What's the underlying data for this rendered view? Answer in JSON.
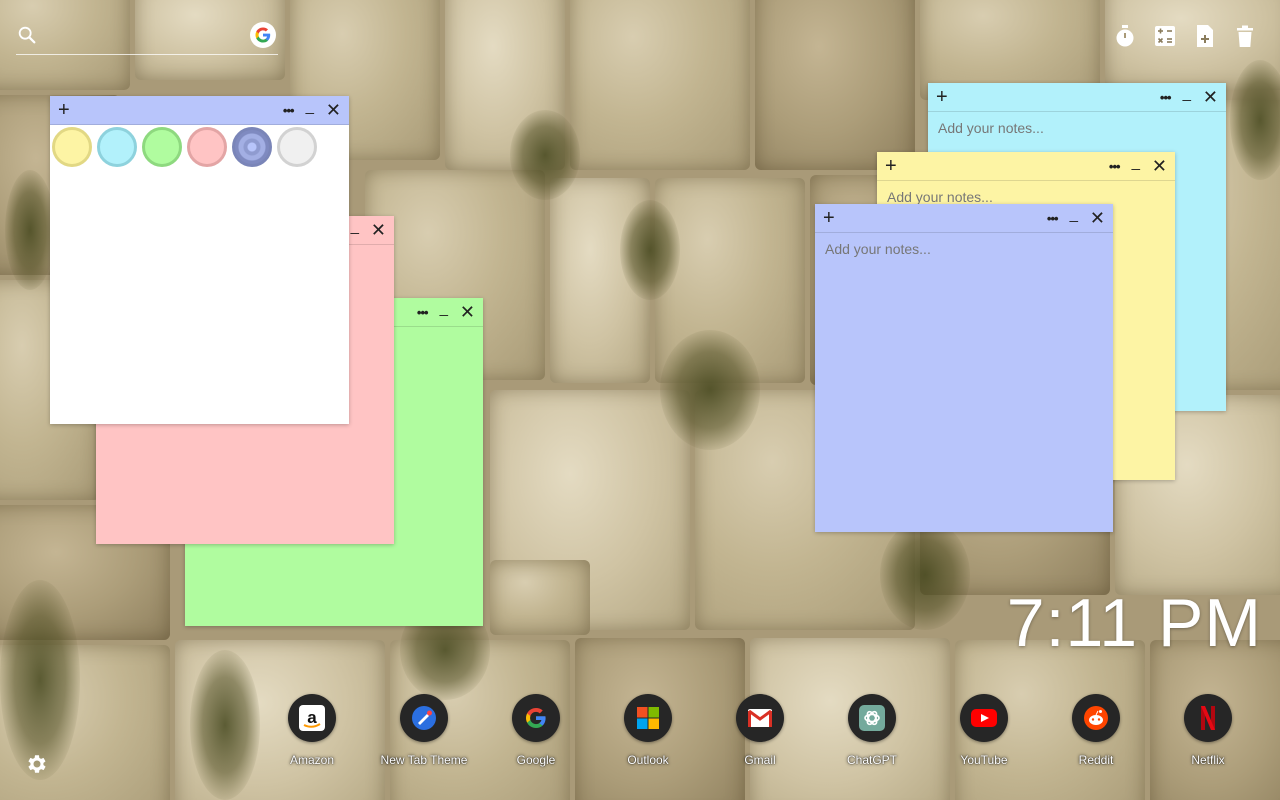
{
  "colors": {
    "yellow": "#fdf4a4",
    "blue": "#b2f1fb",
    "green": "#b0fc9f",
    "pink": "#ffc4c4",
    "lavender": "#b8c5fb",
    "white": "#ffffff"
  },
  "topbar": {
    "search_icon": "search-icon",
    "google_icon": "google-g-icon",
    "tools": [
      "timer-icon",
      "calculator-icon",
      "new-note-icon",
      "trash-icon"
    ]
  },
  "notes": [
    {
      "id": "white",
      "placeholder": ""
    },
    {
      "id": "pink",
      "placeholder": ""
    },
    {
      "id": "green",
      "placeholder": ""
    },
    {
      "id": "blue",
      "placeholder": "Add your notes..."
    },
    {
      "id": "yellow",
      "placeholder": "Add your notes..."
    },
    {
      "id": "lavender",
      "placeholder": "Add your notes..."
    }
  ],
  "color_picker": [
    "yellow",
    "blue",
    "green",
    "pink",
    "lavender",
    "white"
  ],
  "clock": "7:11 PM",
  "dock": [
    {
      "label": "Amazon",
      "icon": "amazon-icon"
    },
    {
      "label": "New Tab Theme",
      "icon": "new-tab-theme-icon"
    },
    {
      "label": "Google",
      "icon": "google-icon"
    },
    {
      "label": "Outlook",
      "icon": "outlook-icon"
    },
    {
      "label": "Gmail",
      "icon": "gmail-icon"
    },
    {
      "label": "ChatGPT",
      "icon": "chatgpt-icon"
    },
    {
      "label": "YouTube",
      "icon": "youtube-icon"
    },
    {
      "label": "Reddit",
      "icon": "reddit-icon"
    },
    {
      "label": "Netflix",
      "icon": "netflix-icon"
    }
  ],
  "settings_icon": "gear-icon"
}
